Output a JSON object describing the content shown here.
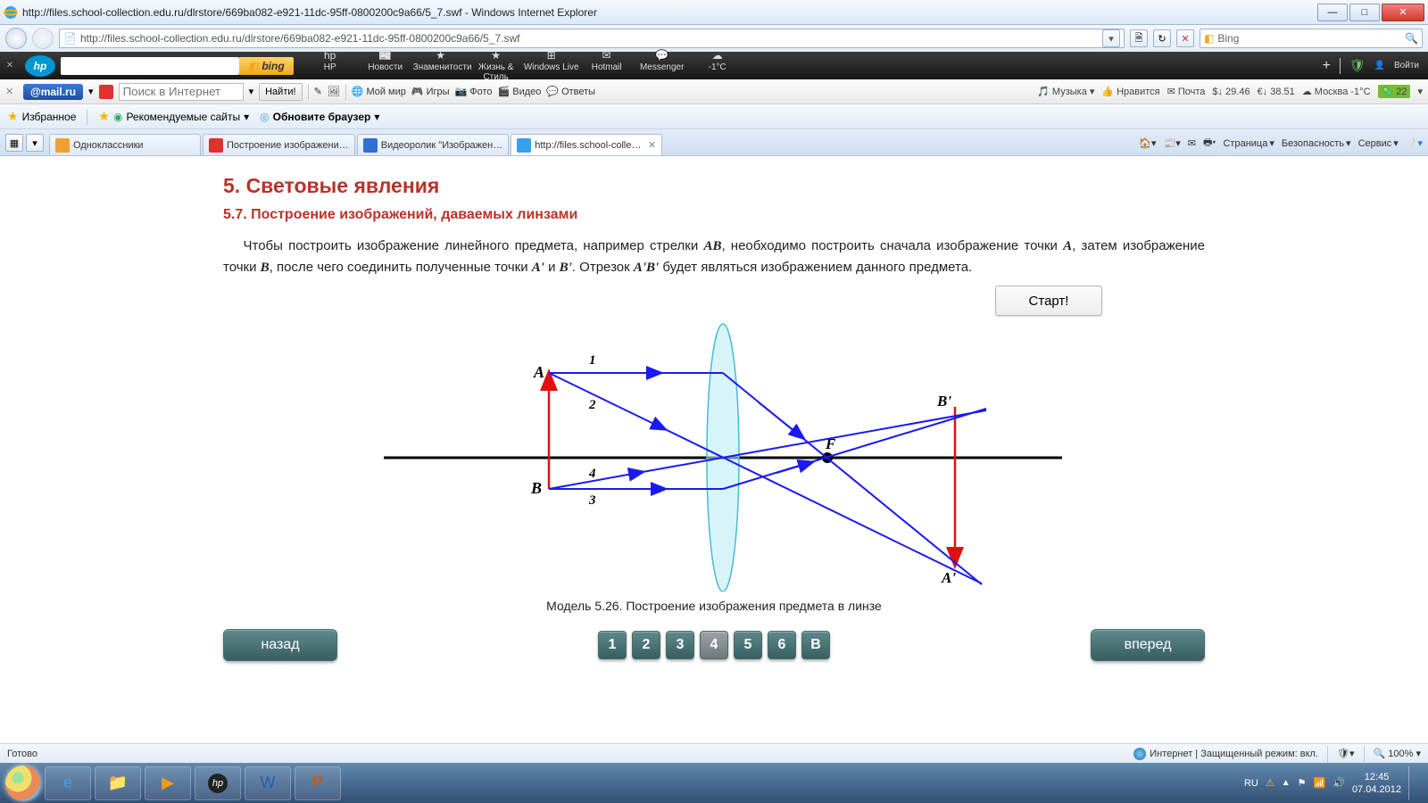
{
  "window": {
    "title": "http://files.school-collection.edu.ru/dlrstore/669ba082-e921-11dc-95ff-0800200c9a66/5_7.swf - Windows Internet Explorer",
    "url": "http://files.school-collection.edu.ru/dlrstore/669ba082-e921-11dc-95ff-0800200c9a66/5_7.swf",
    "search_placeholder": "Bing"
  },
  "hp_toolbar": {
    "labels": [
      "HP",
      "Новости",
      "Знаменитости",
      "Жизнь & Стиль",
      "Windows Live",
      "Hotmail",
      "Messenger",
      "-1°C"
    ],
    "bing": "bing",
    "login": "Войти"
  },
  "mail_toolbar": {
    "logo": "@mail.ru",
    "search_placeholder": "Поиск в Интернет",
    "go": "Найти!",
    "links": [
      "Мой мир",
      "Игры",
      "Фото",
      "Видео",
      "Ответы"
    ],
    "right": {
      "music": "Музыка",
      "like": "Нравится",
      "mail": "Почта",
      "rate1": "$↓ 29.46",
      "rate2": "€↓ 38.51",
      "city": "Москва -1°C",
      "extra": "22"
    }
  },
  "favorites": {
    "label": "Избранное",
    "items": [
      "Рекомендуемые сайты",
      "Обновите браузер"
    ]
  },
  "tabs": [
    {
      "label": "Одноклассники",
      "active": false,
      "fav": "ok"
    },
    {
      "label": "Построение изображени…",
      "active": false,
      "fav": "y"
    },
    {
      "label": "Видеоролик \"Изображен…",
      "active": false,
      "fav": "b"
    },
    {
      "label": "http://files.school-colle…",
      "active": true,
      "fav": "ie"
    }
  ],
  "cmdbar": {
    "items": [
      "Страница",
      "Безопасность",
      "Сервис"
    ]
  },
  "article": {
    "h1": "5. Световые явления",
    "h2": "5.7. Построение изображений, даваемых линзами",
    "p1a": "Чтобы построить изображение линейного предмета, например стрелки ",
    "AB": "AB",
    "p1b": ", необходимо построить сначала изображение точки ",
    "A": "A",
    "p1c": ", затем изображение точки ",
    "B": "B",
    "p1d": ", после чего соединить полученные точки ",
    "Ap": "A'",
    "p1e": " и ",
    "Bp": "B'",
    "p1f": ". Отрезок ",
    "ApBp": "A'B'",
    "p1g": " будет являться изображением данного предмета.",
    "start": "Старт!",
    "caption": "Модель 5.26. Построение изображения предмета в линзе",
    "back": "назад",
    "forward": "вперед",
    "pages": [
      "1",
      "2",
      "3",
      "4",
      "5",
      "6",
      "В"
    ],
    "current_page_index": 3
  },
  "diagram_labels": {
    "A": "A",
    "B": "B",
    "F": "F",
    "Ap": "A'",
    "Bp": "B'",
    "r1": "1",
    "r2": "2",
    "r3": "3",
    "r4": "4"
  },
  "statusbar": {
    "left": "Готово",
    "zone": "Интернет | Защищенный режим: вкл.",
    "zoom": "100%"
  },
  "taskbar": {
    "lang": "RU",
    "time": "12:45",
    "date": "07.04.2012"
  }
}
